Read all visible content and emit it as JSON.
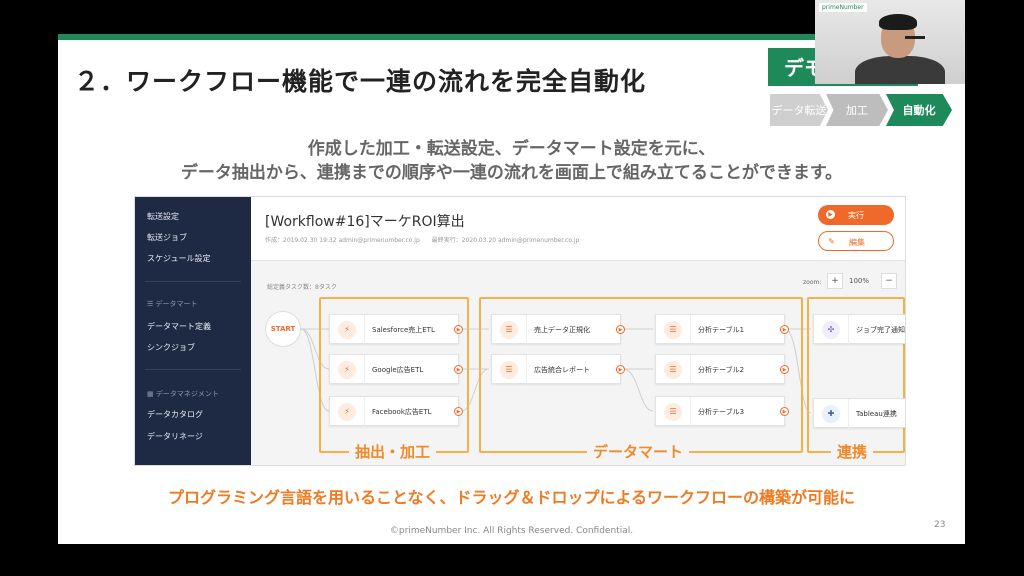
{
  "slide": {
    "title": "２．ワークフロー機能で一連の流れを完全自動化",
    "badge": "デモ",
    "steps": [
      "データ転送",
      "加工",
      "自動化"
    ],
    "subtitle_line1": "作成した加工・転送設定、データマート設定を元に、",
    "subtitle_line2": "データ抽出から、連携までの順序や一連の流れを画面上で組み立てることができます。",
    "bottom_message": "プログラミング言語を用いることなく、ドラッグ＆ドロップによるワークフローの構築が可能に",
    "footer": "©primeNumber Inc. All Rights Reserved. Confidential.",
    "page_number": "23"
  },
  "app": {
    "sidebar": {
      "items_top": [
        "転送設定",
        "転送ジョブ",
        "スケジュール設定"
      ],
      "section_datamart": "データマート",
      "items_datamart": [
        "データマート定義",
        "シンクジョブ"
      ],
      "section_data_mgmt": "データマネジメント",
      "items_data_mgmt": [
        "データカタログ",
        "データリネージ"
      ]
    },
    "header": {
      "title": "[Workflow#16]マーケROI算出",
      "meta": "作成：2019.02.30 19:32 admin@primenumber.co.jp　　最終実行：2020.03.20 admin@primenumber.co.jp",
      "run_label": "実行",
      "edit_label": "編集"
    },
    "canvas": {
      "task_count": "総定義タスク数：8タスク",
      "zoom_label": "zoom:",
      "zoom_value": "100%",
      "zoom_plus": "+",
      "zoom_minus": "−",
      "start_label": "START",
      "groups": [
        "抽出・加工",
        "データマート",
        "連携"
      ],
      "etl_nodes": [
        "Salesforce売上ETL",
        "Google広告ETL",
        "Facebook広告ETL"
      ],
      "mart_nodes": [
        "売上データ正規化",
        "広告統合レポート"
      ],
      "table_nodes": [
        "分析テーブル1",
        "分析テーブル2",
        "分析テーブル3"
      ],
      "output_nodes": [
        "ジョブ完了通知",
        "Tableau連携"
      ]
    }
  },
  "webcam": {
    "logo": "primeNumber"
  },
  "colors": {
    "brand_green": "#1e8a5a",
    "accent_orange": "#ef6a2a",
    "sidebar_navy": "#1e2a44"
  }
}
